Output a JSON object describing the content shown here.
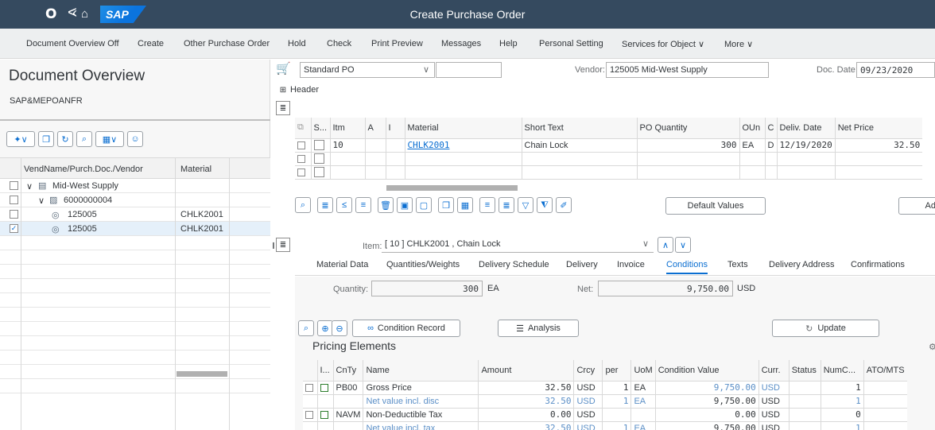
{
  "shell": {
    "title": "Create Purchase Order",
    "logo_text": "SAP",
    "icons": [
      "user-icon",
      "back-icon",
      "home-icon"
    ]
  },
  "toolbar": {
    "items": [
      "Document Overview Off",
      "Create",
      "Other Purchase Order",
      "Hold",
      "Check",
      "Print Preview",
      "Messages",
      "Help",
      "Personal Setting",
      "Services for Object ∨",
      "More ∨"
    ]
  },
  "left": {
    "title": "Document Overview",
    "subtitle": "SAP&MEPOANFR",
    "tree_headers": [
      "VendName/Purch.Doc./Vendor",
      "Material"
    ],
    "tree_rows": [
      {
        "label": "Mid-West Supply",
        "material": "",
        "checked": false
      },
      {
        "label": "6000000004",
        "material": "",
        "checked": false
      },
      {
        "label": "125005",
        "material": "CHLK2001",
        "checked": false
      },
      {
        "label": "125005",
        "material": "CHLK2001",
        "checked": true
      }
    ]
  },
  "header": {
    "po_type": "Standard PO",
    "vendor_label": "Vendor:",
    "vendor_value": "125005 Mid-West Supply",
    "docdate_label": "Doc. Date:",
    "docdate_value": "09/23/2020",
    "header_label": "Header"
  },
  "items_table": {
    "headers": [
      "S...",
      "Itm",
      "A",
      "I",
      "Material",
      "Short Text",
      "PO Quantity",
      "OUn",
      "C",
      "Deliv. Date",
      "Net Price"
    ],
    "rows": [
      {
        "itm": "10",
        "material": "CHLK2001",
        "short_text": "Chain Lock",
        "qty": "300",
        "oun": "EA",
        "c": "D",
        "deliv_date": "12/19/2020",
        "net_price": "32.50"
      }
    ],
    "default_values_btn": "Default Values",
    "add_btn": "Ad"
  },
  "item_detail": {
    "item_label": "Item:",
    "item_value": "[ 10 ] CHLK2001 , Chain Lock",
    "tabs": [
      "Material Data",
      "Quantities/Weights",
      "Delivery Schedule",
      "Delivery",
      "Invoice",
      "Conditions",
      "Texts",
      "Delivery Address",
      "Confirmations"
    ],
    "active_tab": "Conditions",
    "quantity_label": "Quantity:",
    "quantity_value": "300",
    "quantity_unit": "EA",
    "net_label": "Net:",
    "net_value": "9,750.00",
    "net_currency": "USD",
    "condition_record_btn": "Condition Record",
    "analysis_btn": "Analysis",
    "update_btn": "Update",
    "pricing_title": "Pricing Elements"
  },
  "pricing_table": {
    "headers": [
      "I...",
      "CnTy",
      "Name",
      "Amount",
      "Crcy",
      "per",
      "UoM",
      "Condition Value",
      "Curr.",
      "Status",
      "NumC...",
      "ATO/MTS"
    ],
    "rows": [
      {
        "cnty": "PB00",
        "name": "Gross Price",
        "amount": "32.50",
        "crcy": "USD",
        "per": "1",
        "uom": "EA",
        "cond_value": "9,750.00",
        "curr": "USD",
        "numc": "1",
        "subtotal": false
      },
      {
        "cnty": "",
        "name": "Net value incl. disc",
        "amount": "32.50",
        "crcy": "USD",
        "per": "1",
        "uom": "EA",
        "cond_value": "9,750.00",
        "curr": "USD",
        "numc": "1",
        "subtotal": true
      },
      {
        "cnty": "NAVM",
        "name": "Non-Deductible Tax",
        "amount": "0.00",
        "crcy": "USD",
        "per": "",
        "uom": "",
        "cond_value": "0.00",
        "curr": "USD",
        "numc": "0",
        "subtotal": false
      },
      {
        "cnty": "",
        "name": "Net value incl. tax",
        "amount": "32.50",
        "crcy": "USD",
        "per": "1",
        "uom": "EA",
        "cond_value": "9,750.00",
        "curr": "USD",
        "numc": "1",
        "subtotal": true
      }
    ]
  },
  "colors": {
    "shell": "#354a5f",
    "accent": "#0a6ed1",
    "toolbar": "#edeff0"
  }
}
